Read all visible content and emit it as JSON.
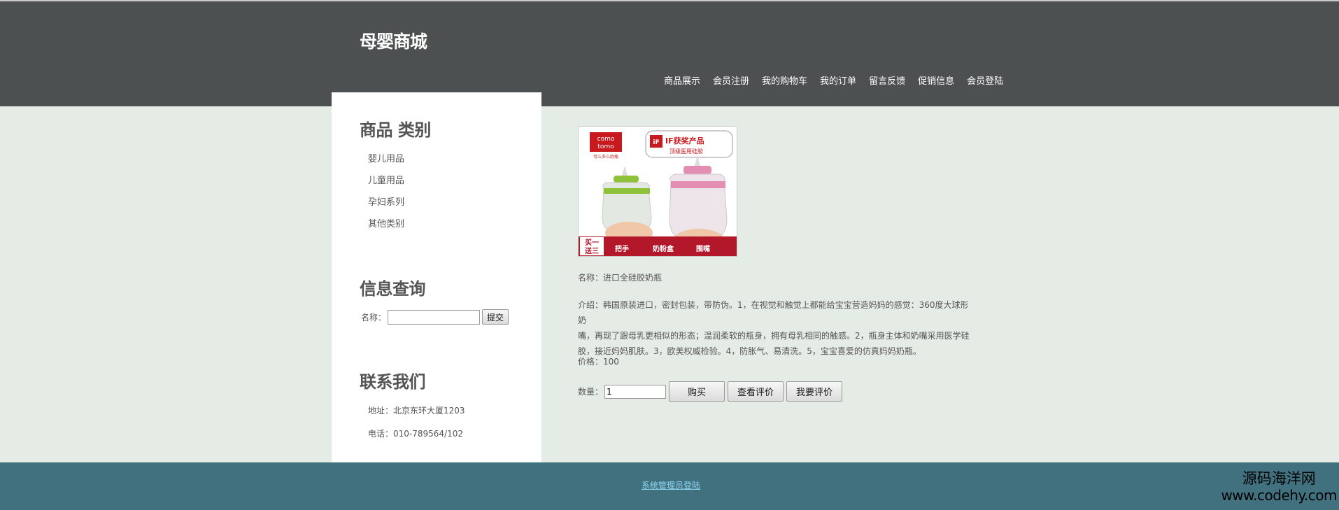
{
  "header": {
    "site_title": "母婴商城",
    "nav": [
      "商品展示",
      "会员注册",
      "我的购物车",
      "我的订单",
      "留言反馈",
      "促销信息",
      "会员登陆"
    ]
  },
  "sidebar": {
    "category_title": "商品 类别",
    "categories": [
      "婴儿用品",
      "儿童用品",
      "孕妇系列",
      "其他类别"
    ],
    "search_title": "信息查询",
    "search_label": "名称：",
    "search_value": "",
    "search_button": "提交",
    "contact_title": "联系我们",
    "address": "地址：北京东环大厦1203",
    "phone": "电话：010-789564/102"
  },
  "product": {
    "image_badges": {
      "brand_line1": "como",
      "brand_line2": "tomo",
      "brand_sub": "可么多么奶瓶",
      "award": "IF获奖产品",
      "award_sub": "顶级医用硅胶",
      "promo_line1": "买一",
      "promo_line2": "送三",
      "gift1": "把手",
      "gift2": "奶粉盒",
      "gift3": "围嘴"
    },
    "name": "名称：进口全硅胶奶瓶",
    "desc_line1": "介绍：韩国原装进口，密封包装，带防伪。1，在视觉和触觉上都能给宝宝营造妈妈的感觉：360度大球形奶",
    "desc_line2": "嘴，再现了跟母乳更相似的形态；温润柔软的瓶身，拥有母乳相同的触感。2，瓶身主体和奶嘴采用医学硅",
    "desc_line3": "胶，接近妈妈肌肤。3，欧美权威检验。4，防胀气、易清洗。5，宝宝喜爱的仿真妈妈奶瓶。",
    "price": "价格：100",
    "qty_label": "数量：",
    "qty_value": "1",
    "buy_button": "购买",
    "view_reviews_button": "查看评价",
    "write_review_button": "我要评价"
  },
  "footer": {
    "admin_link": "系统管理员登陆"
  },
  "watermark": {
    "line1": "源码海洋网",
    "line2": "www.codehy.com"
  },
  "colors": {
    "header_bg": "#4c5050",
    "page_bg": "#e5ebe5",
    "footer_bg": "#41717f",
    "footer_link": "#8fd6f2"
  }
}
